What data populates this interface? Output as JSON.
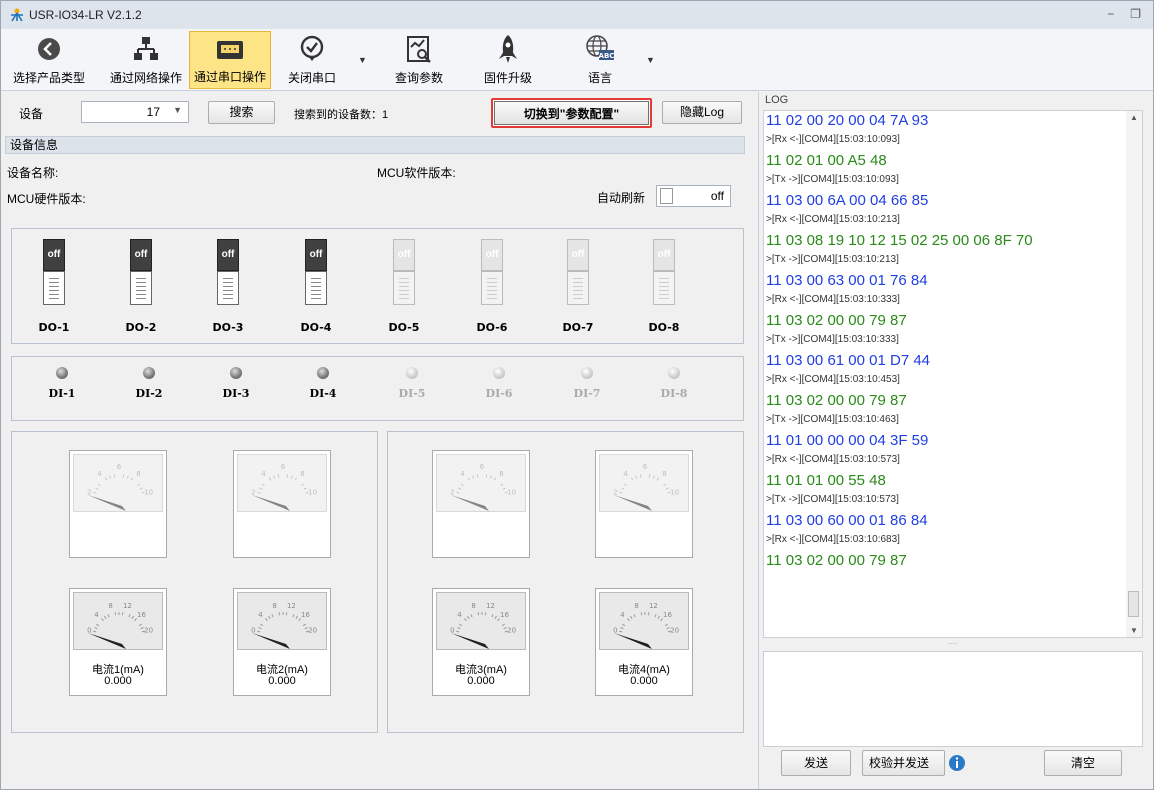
{
  "app": {
    "title": "USR-IO34-LR V2.1.2"
  },
  "toolbar": {
    "items": [
      {
        "label": "选择产品类型",
        "icon": "back-arrow-icon"
      },
      {
        "label": "通过网络操作",
        "icon": "network-icon"
      },
      {
        "label": "通过串口操作",
        "icon": "serial-port-icon"
      },
      {
        "label": "关闭串口",
        "icon": "check-circle-icon"
      },
      {
        "label": "查询参数",
        "icon": "query-chart-icon"
      },
      {
        "label": "固件升级",
        "icon": "rocket-icon"
      },
      {
        "label": "语言",
        "icon": "globe-abc-icon"
      }
    ]
  },
  "device": {
    "label": "设备",
    "value": "17",
    "search_label": "搜索",
    "found_label": "搜索到的设备数：1",
    "switch_label": "切换到\"参数配置\"",
    "hide_log_label": "隐藏Log"
  },
  "info": {
    "section": "设备信息",
    "name_label": "设备名称:",
    "mcu_sw_label": "MCU软件版本:",
    "mcu_hw_label": "MCU硬件版本:",
    "auto_refresh_label": "自动刷新",
    "auto_refresh_value": "off"
  },
  "outputs": [
    {
      "label": "DO-1",
      "state": "off"
    },
    {
      "label": "DO-2",
      "state": "off"
    },
    {
      "label": "DO-3",
      "state": "off"
    },
    {
      "label": "DO-4",
      "state": "off"
    },
    {
      "label": "DO-5",
      "state": "off"
    },
    {
      "label": "DO-6",
      "state": "off"
    },
    {
      "label": "DO-7",
      "state": "off"
    },
    {
      "label": "DO-8",
      "state": "off"
    }
  ],
  "inputs": [
    {
      "label": "DI-1"
    },
    {
      "label": "DI-2"
    },
    {
      "label": "DI-3"
    },
    {
      "label": "DI-4"
    },
    {
      "label": "DI-5"
    },
    {
      "label": "DI-6"
    },
    {
      "label": "DI-7"
    },
    {
      "label": "DI-8"
    }
  ],
  "gauges": {
    "voltage_ticks": [
      "2",
      "4",
      "6",
      "8",
      "10"
    ],
    "current_ticks": [
      "0",
      "4",
      "8",
      "12",
      "16",
      "20"
    ],
    "current": [
      {
        "label": "电流1(mA)",
        "value": "0.000"
      },
      {
        "label": "电流2(mA)",
        "value": "0.000"
      },
      {
        "label": "电流3(mA)",
        "value": "0.000"
      },
      {
        "label": "电流4(mA)",
        "value": "0.000"
      }
    ]
  },
  "log": {
    "title": "LOG",
    "lines": [
      {
        "text": "11 02 00 20 00 04 7A 93",
        "kind": "tx"
      },
      {
        "text": ">[Rx <-][COM4][15:03:10:093]",
        "kind": "meta"
      },
      {
        "text": "11 02 01 00 A5 48",
        "kind": "rx"
      },
      {
        "text": ">[Tx ->][COM4][15:03:10:093]",
        "kind": "meta"
      },
      {
        "text": "11 03 00 6A 00 04 66 85",
        "kind": "tx"
      },
      {
        "text": ">[Rx <-][COM4][15:03:10:213]",
        "kind": "meta"
      },
      {
        "text": "11 03 08 19 10 12 15 02 25 00 06 8F 70",
        "kind": "rx"
      },
      {
        "text": ">[Tx ->][COM4][15:03:10:213]",
        "kind": "meta"
      },
      {
        "text": "11 03 00 63 00 01 76 84",
        "kind": "tx"
      },
      {
        "text": ">[Rx <-][COM4][15:03:10:333]",
        "kind": "meta"
      },
      {
        "text": "11 03 02 00 00 79 87",
        "kind": "rx"
      },
      {
        "text": ">[Tx ->][COM4][15:03:10:333]",
        "kind": "meta"
      },
      {
        "text": "11 03 00 61 00 01 D7 44",
        "kind": "tx"
      },
      {
        "text": ">[Rx <-][COM4][15:03:10:453]",
        "kind": "meta"
      },
      {
        "text": "11 03 02 00 00 79 87",
        "kind": "rx"
      },
      {
        "text": ">[Tx ->][COM4][15:03:10:463]",
        "kind": "meta"
      },
      {
        "text": "11 01 00 00 00 04 3F 59",
        "kind": "tx"
      },
      {
        "text": ">[Rx <-][COM4][15:03:10:573]",
        "kind": "meta"
      },
      {
        "text": "11 01 01 00 55 48",
        "kind": "rx"
      },
      {
        "text": ">[Tx ->][COM4][15:03:10:573]",
        "kind": "meta"
      },
      {
        "text": "11 03 00 60 00 01 86 84",
        "kind": "tx"
      },
      {
        "text": ">[Rx <-][COM4][15:03:10:683]",
        "kind": "meta"
      },
      {
        "text": "11 03 02 00 00 79 87",
        "kind": "rx"
      }
    ],
    "splitter": "....",
    "send_label": "发送",
    "verify_send_label": "校验并发送",
    "clear_label": "清空"
  },
  "colors": {
    "tx": "#1f3fe0",
    "rx": "#2a8a1a",
    "highlight": "#e53935",
    "active_tab": "#fde487"
  }
}
